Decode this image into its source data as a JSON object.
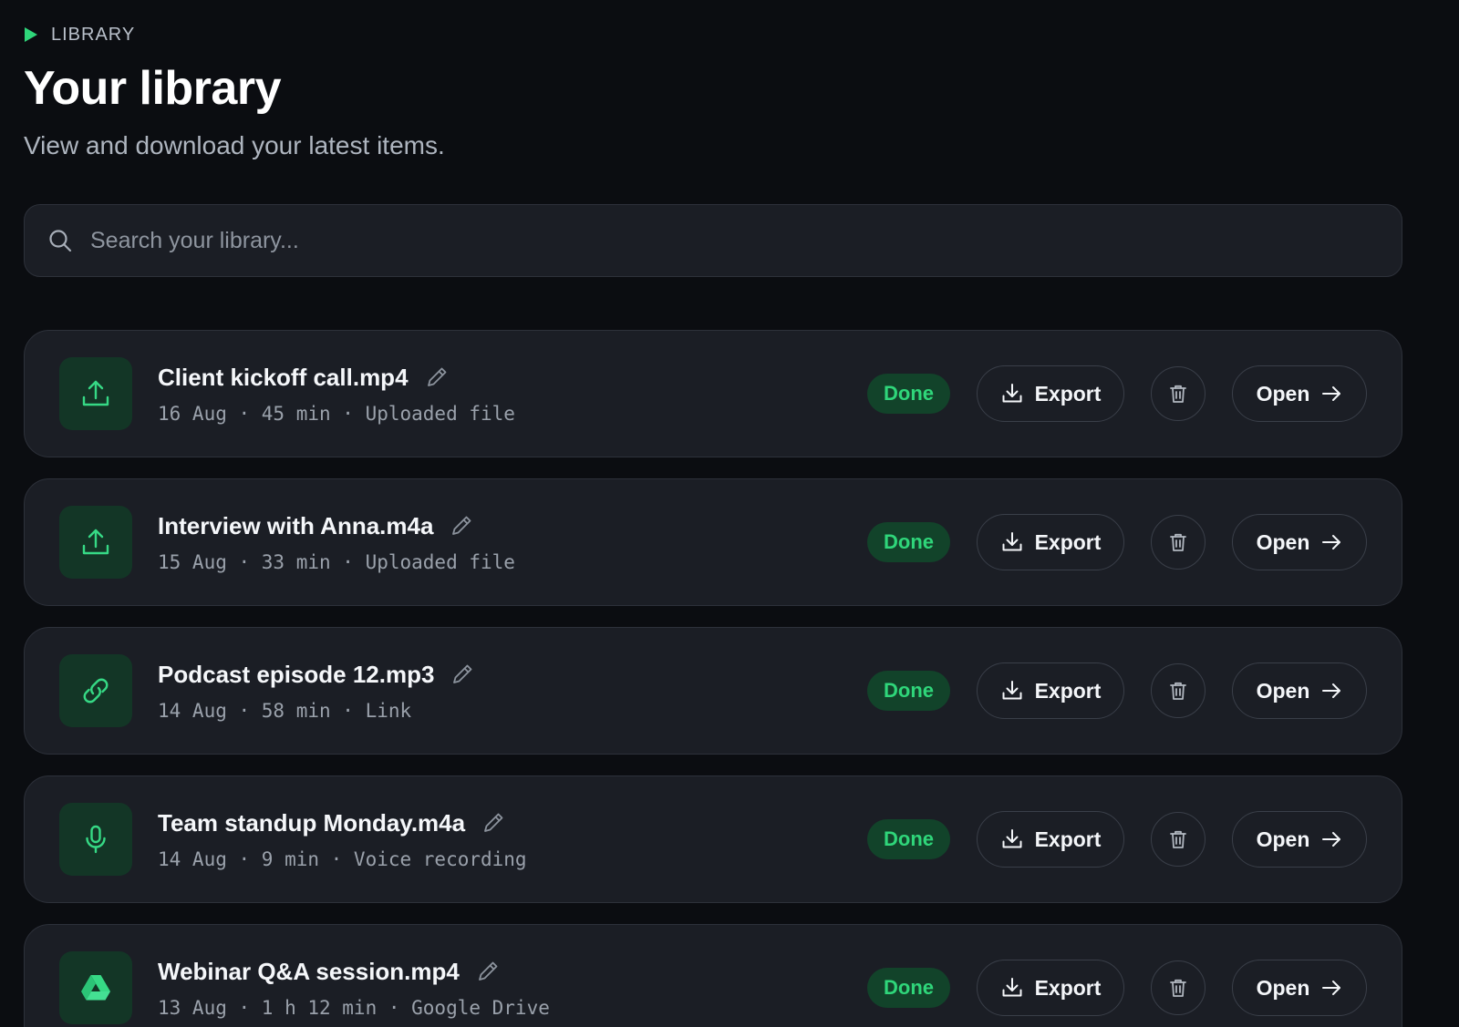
{
  "header": {
    "eyebrow": "LIBRARY",
    "title": "Your library",
    "subtitle": "View and download your latest items."
  },
  "search": {
    "placeholder": "Search your library...",
    "value": ""
  },
  "items": [
    {
      "title": "Client kickoff call.mp4",
      "meta": "16 Aug · 45 min · Uploaded file",
      "icon": "upload-icon",
      "status": "Done",
      "export_label": "Export",
      "open_label": "Open"
    },
    {
      "title": "Interview with Anna.m4a",
      "meta": "15 Aug · 33 min · Uploaded file",
      "icon": "upload-icon",
      "status": "Done",
      "export_label": "Export",
      "open_label": "Open"
    },
    {
      "title": "Podcast episode 12.mp3",
      "meta": "14 Aug · 58 min · Link",
      "icon": "link-icon",
      "status": "Done",
      "export_label": "Export",
      "open_label": "Open"
    },
    {
      "title": "Team standup Monday.m4a",
      "meta": "14 Aug · 9 min · Voice recording",
      "icon": "microphone-icon",
      "status": "Done",
      "export_label": "Export",
      "open_label": "Open"
    },
    {
      "title": "Webinar Q&A session.mp4",
      "meta": "13 Aug · 1 h 12 min · Google Drive",
      "icon": "google-drive-icon",
      "status": "Done",
      "export_label": "Export",
      "open_label": "Open"
    }
  ],
  "colors": {
    "background": "#0b0d11",
    "card": "#1b1e25",
    "accent": "#2fd67a",
    "badge_bg": "#12432a",
    "thumb_bg": "#133626"
  }
}
